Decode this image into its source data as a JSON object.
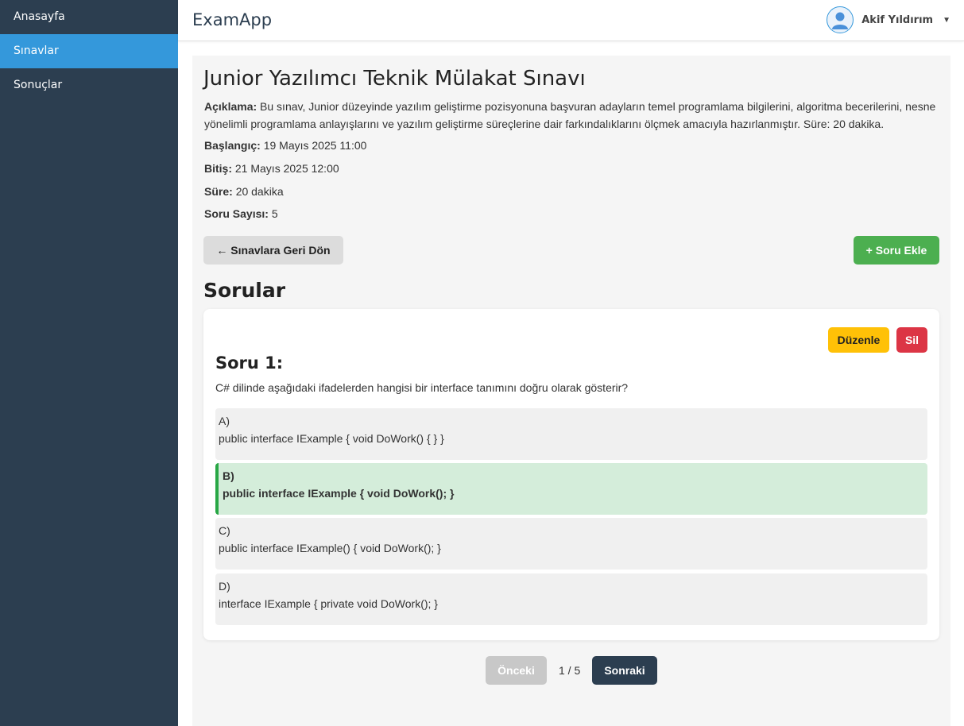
{
  "sidebar": {
    "items": [
      {
        "label": "Anasayfa",
        "active": false
      },
      {
        "label": "Sınavlar",
        "active": true
      },
      {
        "label": "Sonuçlar",
        "active": false
      }
    ]
  },
  "header": {
    "brand": "ExamApp",
    "user_name": "Akif Yıldırım",
    "avatar_icon": "user-avatar-icon",
    "caret_icon": "caret-down-icon"
  },
  "exam": {
    "title": "Junior Yazılımcı Teknik Mülakat Sınavı",
    "description_label": "Açıklama:",
    "description": "Bu sınav, Junior düzeyinde yazılım geliştirme pozisyonuna başvuran adayların temel programlama bilgilerini, algoritma becerilerini, nesne yönelimli programlama anlayışlarını ve yazılım geliştirme süreçlerine dair farkındalıklarını ölçmek amacıyla hazırlanmıştır. Süre: 20 dakika.",
    "start_label": "Başlangıç:",
    "start": "19 Mayıs 2025 11:00",
    "end_label": "Bitiş:",
    "end": "21 Mayıs 2025 12:00",
    "duration_label": "Süre:",
    "duration": "20 dakika",
    "question_count_label": "Soru Sayısı:",
    "question_count": "5"
  },
  "actions": {
    "back_label": "← Sınavlara Geri Dön",
    "add_question_label": "+ Soru Ekle"
  },
  "questions_section": {
    "title": "Sorular",
    "edit_label": "Düzenle",
    "delete_label": "Sil",
    "question_title": "Soru 1:",
    "question_text": "C# dilinde aşağıdaki ifadelerden hangisi bir interface tanımını doğru olarak gösterir?",
    "options": [
      {
        "letter": "A)",
        "text": "public interface IExample { void DoWork() { } }",
        "correct": false
      },
      {
        "letter": "B)",
        "text": "public interface IExample { void DoWork(); }",
        "correct": true
      },
      {
        "letter": "C)",
        "text": "public interface IExample() { void DoWork(); }",
        "correct": false
      },
      {
        "letter": "D)",
        "text": "interface IExample { private void DoWork(); }",
        "correct": false
      }
    ]
  },
  "pagination": {
    "prev_label": "Önceki",
    "indicator": "1 / 5",
    "next_label": "Sonraki"
  },
  "colors": {
    "sidebar_bg": "#2c3e50",
    "sidebar_active": "#3498db",
    "add_button": "#4caf50",
    "edit_button": "#ffc107",
    "delete_button": "#dc3545",
    "correct_option_bg": "#d4edda",
    "correct_option_border": "#28a745"
  }
}
